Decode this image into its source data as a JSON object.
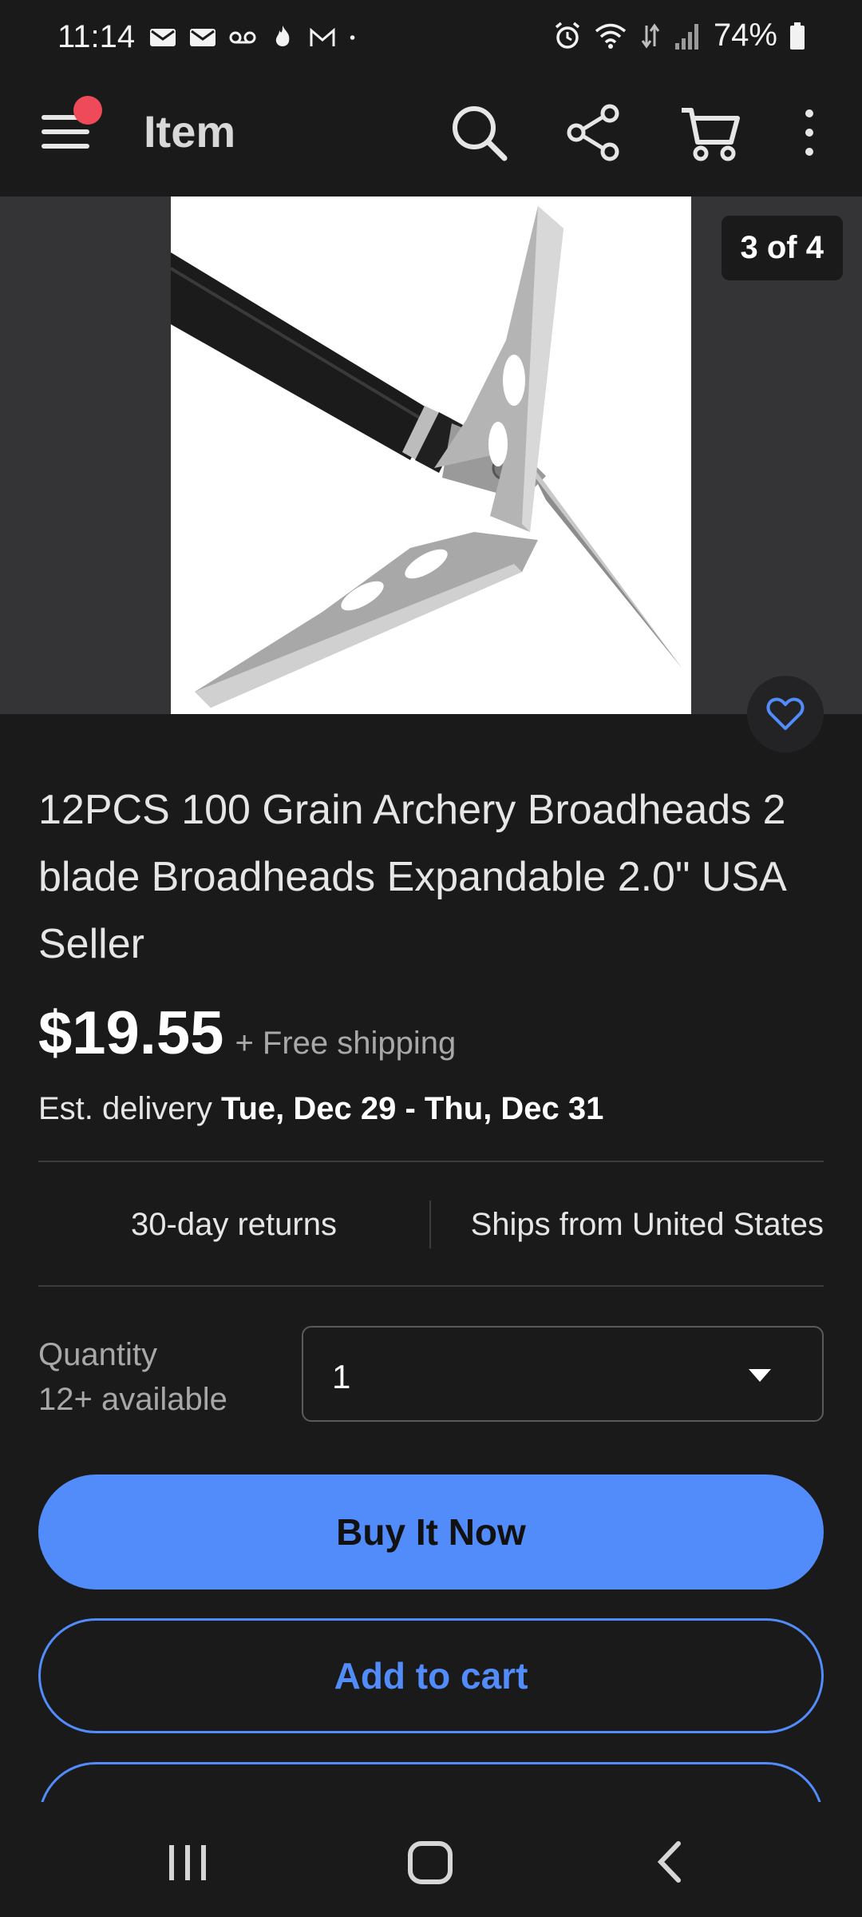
{
  "status_bar": {
    "time": "11:14",
    "battery": "74%",
    "left_icons": [
      "email-icon",
      "email-icon",
      "voicemail-icon",
      "fire-icon",
      "gmail-icon",
      "dot-icon"
    ],
    "right_icons": [
      "alarm-icon",
      "wifi-icon",
      "signal-icon",
      "battery-icon"
    ]
  },
  "app_bar": {
    "title": "Item",
    "icons": [
      "menu-icon",
      "search-icon",
      "share-icon",
      "cart-icon",
      "more-icon"
    ],
    "notification_color": "#ef4a5a"
  },
  "gallery": {
    "counter": "3 of 4",
    "image_alt": "broadhead-arrow-photo"
  },
  "listing": {
    "title": "12PCS 100 Grain Archery Broadheads 2 blade Broadheads Expandable 2.0\" USA Seller",
    "price": "$19.55",
    "shipping": "+ Free shipping",
    "delivery_prefix": "Est. delivery",
    "delivery_dates": "Tue, Dec 29 - Thu, Dec 31",
    "returns": "30-day returns",
    "ships_from": "Ships from United States"
  },
  "quantity": {
    "label": "Quantity",
    "available": "12+ available",
    "selected": "1"
  },
  "actions": {
    "buy_now": "Buy It Now",
    "add_to_cart": "Add to cart"
  },
  "colors": {
    "accent": "#528cfa",
    "background": "#1a1a1b"
  }
}
